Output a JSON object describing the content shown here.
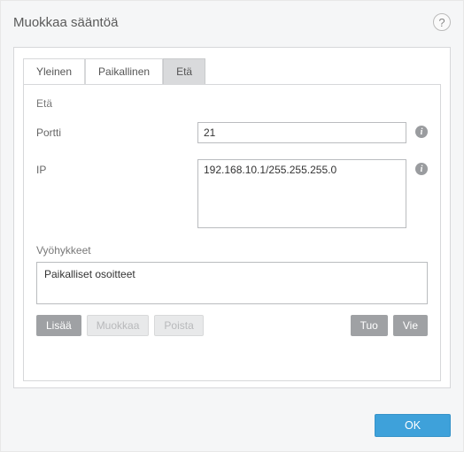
{
  "window": {
    "title": "Muokkaa sääntöä"
  },
  "tabs": {
    "general": "Yleinen",
    "local": "Paikallinen",
    "remote": "Etä"
  },
  "remote": {
    "heading": "Etä",
    "port_label": "Portti",
    "port_value": "21",
    "ip_label": "IP",
    "ip_value": "192.168.10.1/255.255.255.0"
  },
  "zones": {
    "label": "Vyöhykkeet",
    "items": [
      "Paikalliset osoitteet"
    ]
  },
  "buttons": {
    "add": "Lisää",
    "edit": "Muokkaa",
    "delete": "Poista",
    "import": "Tuo",
    "export": "Vie",
    "ok": "OK"
  }
}
